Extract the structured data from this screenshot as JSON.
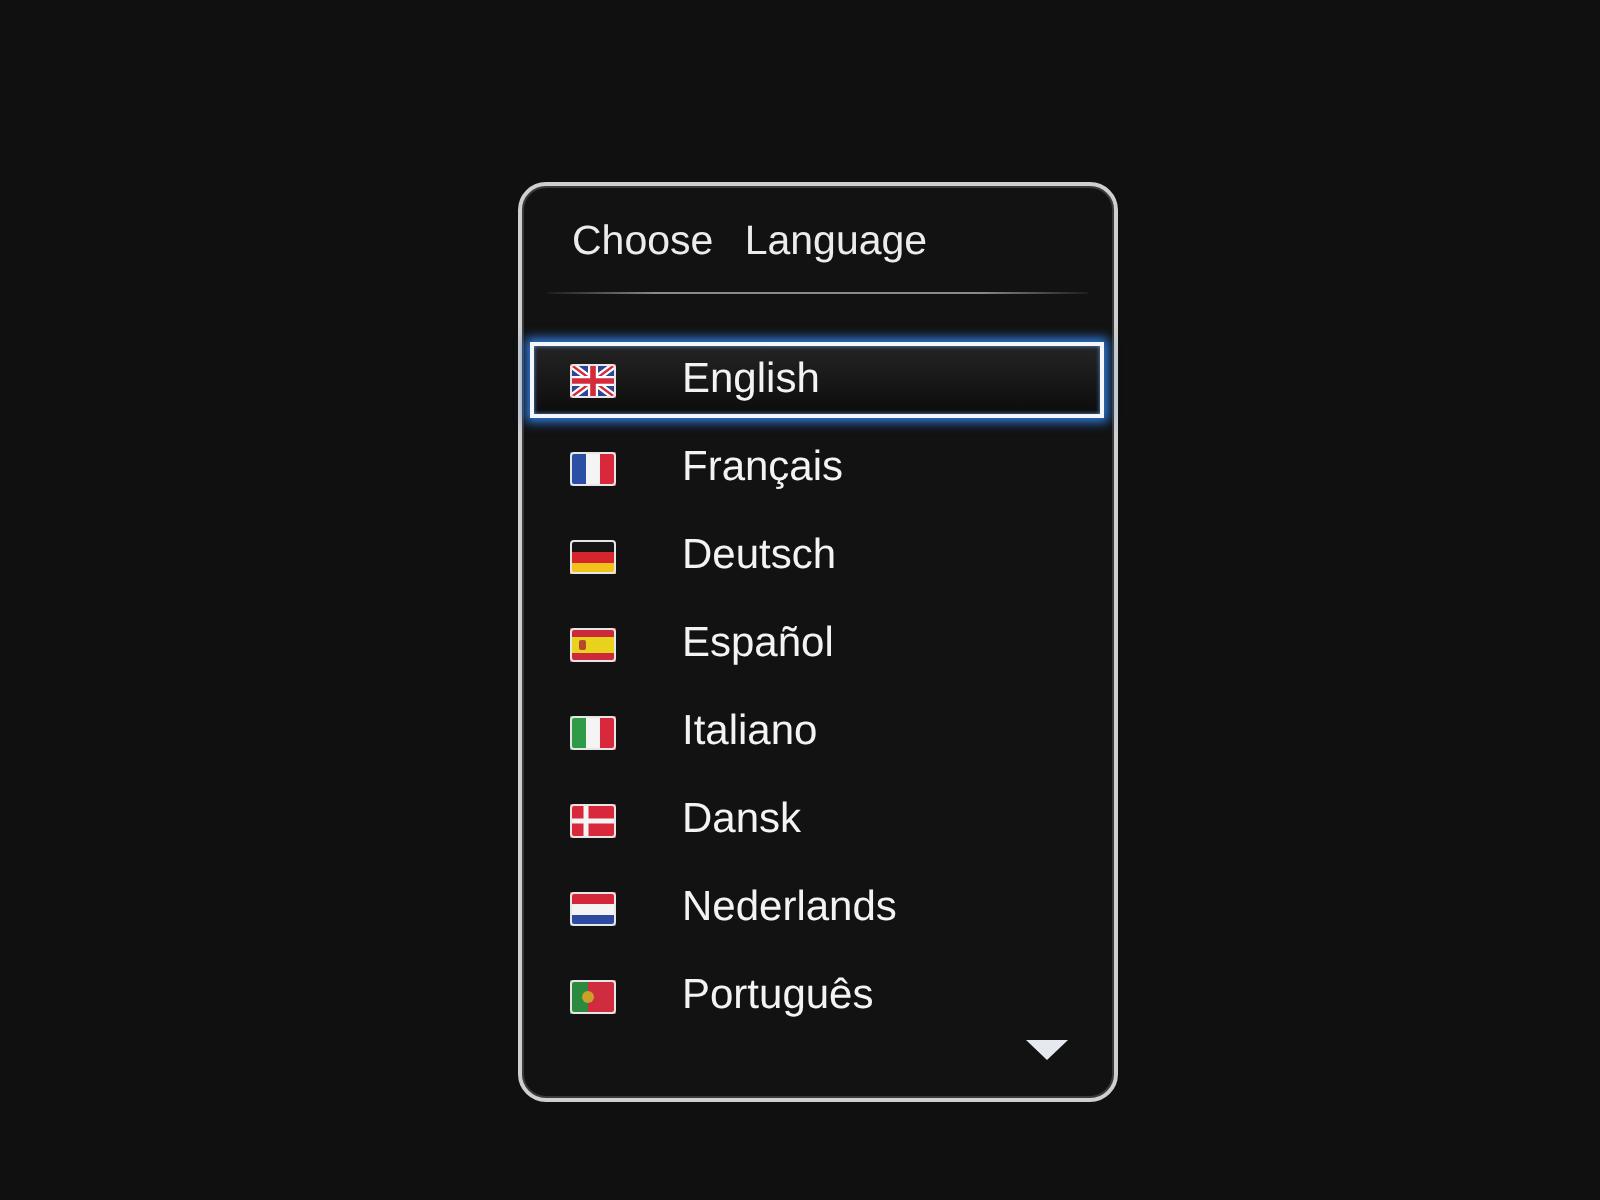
{
  "dialog": {
    "title": "Choose Language"
  },
  "languages": [
    {
      "label": "English",
      "kind": "uk",
      "selected": true
    },
    {
      "label": "Français",
      "kind": "fr",
      "selected": false
    },
    {
      "label": "Deutsch",
      "kind": "de",
      "selected": false
    },
    {
      "label": "Español",
      "kind": "es",
      "selected": false
    },
    {
      "label": "Italiano",
      "kind": "it",
      "selected": false
    },
    {
      "label": "Dansk",
      "kind": "dk",
      "selected": false
    },
    {
      "label": "Nederlands",
      "kind": "nl",
      "selected": false
    },
    {
      "label": "Português",
      "kind": "pt",
      "selected": false
    }
  ]
}
